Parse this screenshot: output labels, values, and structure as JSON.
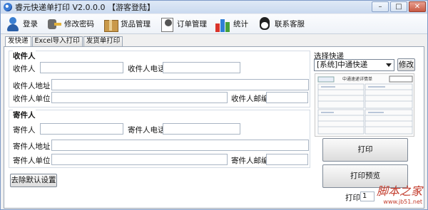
{
  "window": {
    "title": "睿元快递单打印 V2.0.0.0 【游客登陆】",
    "min": "–",
    "max": "□",
    "close": "✕"
  },
  "toolbar": [
    {
      "icon": "user-icon",
      "label": "登录"
    },
    {
      "icon": "key-icon",
      "label": "修改密码"
    },
    {
      "icon": "box-icon",
      "label": "货品管理"
    },
    {
      "icon": "order-icon",
      "label": "订单管理"
    },
    {
      "icon": "stats-icon",
      "label": "统计"
    },
    {
      "icon": "qq-icon",
      "label": "联系客服"
    }
  ],
  "tabs": [
    "发快递",
    "Excel导入打印",
    "发货单打印"
  ],
  "receiver": {
    "title": "收件人",
    "name_label": "收件人",
    "phone_label": "收件人电话",
    "address_label": "收件人地址",
    "company_label": "收件人单位",
    "postcode_label": "收件人邮编"
  },
  "sender": {
    "title": "寄件人",
    "name_label": "寄件人",
    "phone_label": "寄件人电话",
    "address_label": "寄件人地址",
    "company_label": "寄件人单位",
    "postcode_label": "寄件人邮编"
  },
  "courier": {
    "label": "选择快递",
    "selected": "[系统]中通快递",
    "edit_button": "修改",
    "preview_title": "中通速递详情单"
  },
  "actions": {
    "clear_defaults": "去除默认设置",
    "print": "打印",
    "print_preview": "打印预览",
    "copies_label": "打印",
    "copies_value": "1"
  },
  "watermark": {
    "main": "脚本之家",
    "url": "www.jb51.net"
  },
  "colors": {
    "window_border": "#7d9ac7",
    "watermark": "#c23a2a",
    "qq_scarf": "#d9342b"
  }
}
